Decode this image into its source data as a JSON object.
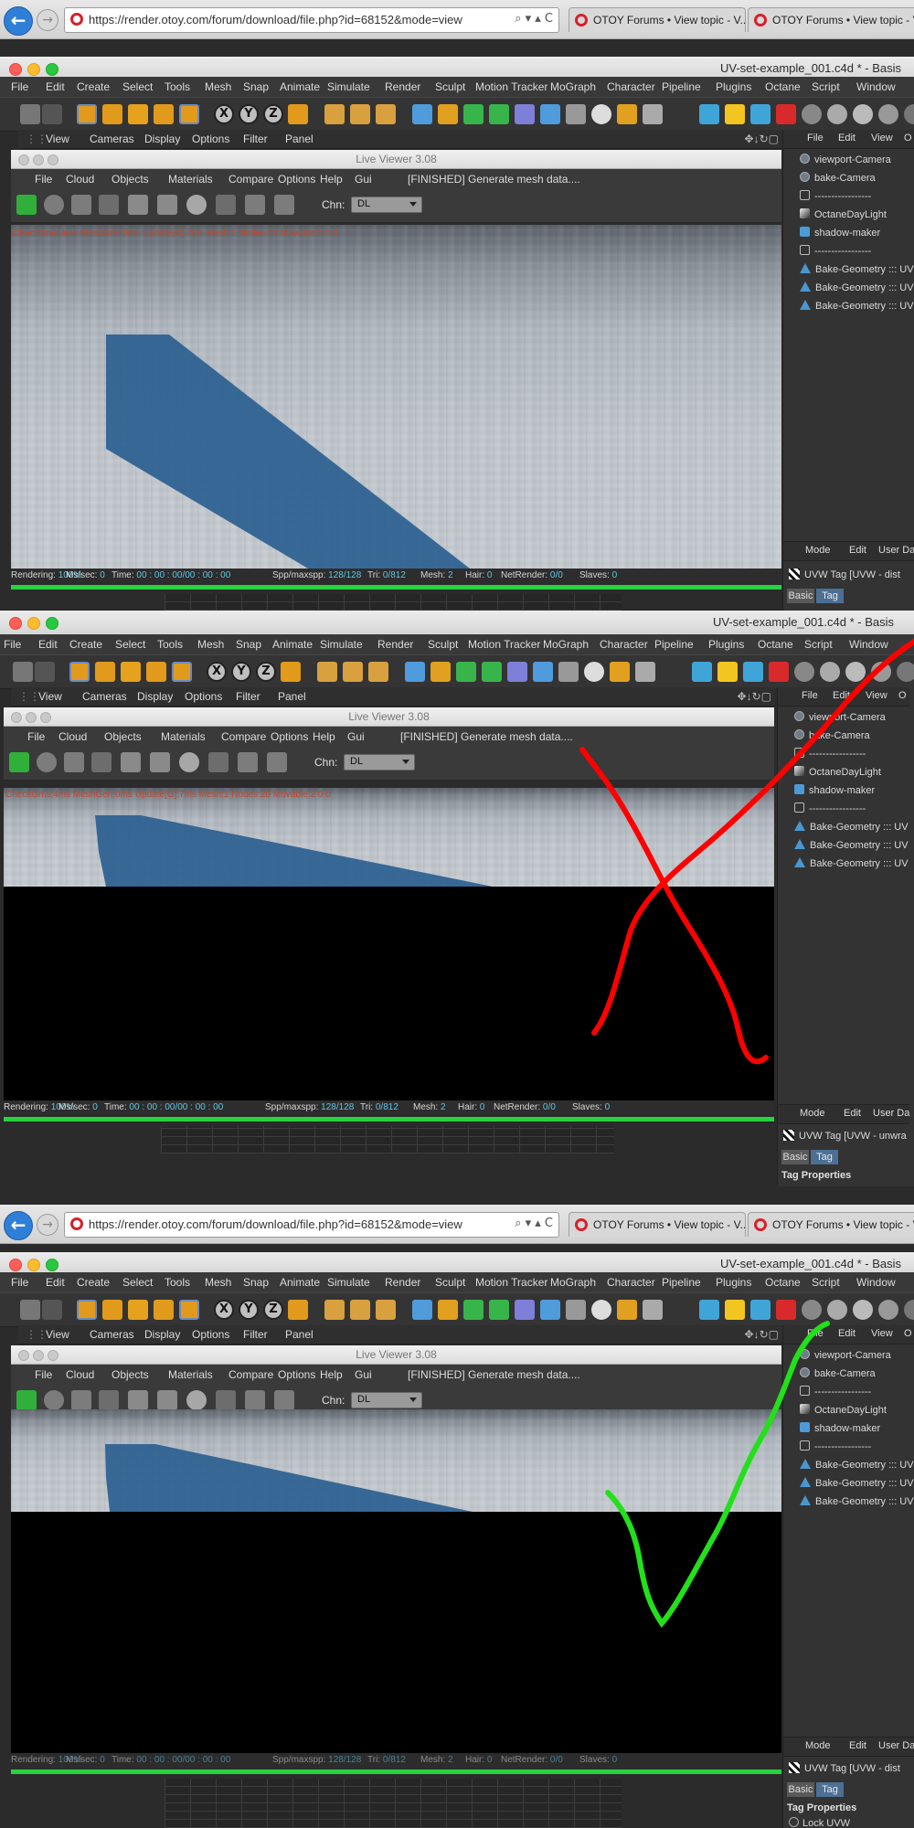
{
  "browser": {
    "url": "https://render.otoy.com/forum/download/file.php?id=68152&mode=view",
    "url_controls": "⌕ ▾ ▴ C",
    "tabs": [
      "OTOY Forums • View topic - V...",
      "OTOY Forums • View topic - V..."
    ]
  },
  "c4d": {
    "window_title": "UV-set-example_001.c4d * - Basis",
    "menu": [
      "File",
      "Edit",
      "Create",
      "Select",
      "Tools",
      "Mesh",
      "Snap",
      "Animate",
      "Simulate",
      "Render",
      "Sculpt",
      "Motion Tracker",
      "MoGraph",
      "Character",
      "Pipeline",
      "Plugins",
      "Octane",
      "Script",
      "Window"
    ],
    "viewport_menu": [
      "View",
      "Cameras",
      "Display",
      "Options",
      "Filter",
      "Panel"
    ],
    "axis_labels": [
      "X",
      "Y",
      "Z"
    ]
  },
  "live_viewer": {
    "title": "Live Viewer 3.08",
    "menu": [
      "File",
      "Cloud",
      "Objects",
      "Materials",
      "Compare",
      "Options",
      "Help",
      "Gui"
    ],
    "status_message": "[FINISHED] Generate mesh data....",
    "channel_label": "Chn:",
    "channel_value": "DL",
    "overlay_text": "CheckGms:4ms MeshGen:0ms Update[G]:7ms Mesh:1 Nodes:20 Movable:2 0 0",
    "render_status": {
      "rendering": {
        "label": "Rendering:",
        "value": "100%"
      },
      "ms_sec": {
        "label": "Ms/sec:",
        "value": "0"
      },
      "time": {
        "label": "Time:",
        "value": "00 : 00 : 00/00 : 00 : 00"
      },
      "spp": {
        "label": "Spp/maxspp:",
        "value": "128/128"
      },
      "tri": {
        "label": "Tri:",
        "value": "0/812"
      },
      "mesh": {
        "label": "Mesh:",
        "value": "2"
      },
      "hair": {
        "label": "Hair:",
        "value": "0"
      },
      "netrender": {
        "label": "NetRender:",
        "value": "0/0"
      },
      "slaves": {
        "label": "Slaves:",
        "value": "0"
      }
    }
  },
  "object_manager": {
    "menu": [
      "File",
      "Edit",
      "View",
      "O"
    ],
    "objects": [
      {
        "name": "viewport-Camera",
        "icon": "camera-icon"
      },
      {
        "name": "bake-Camera",
        "icon": "camera-icon"
      },
      {
        "name": "-----------------",
        "icon": "null-icon"
      },
      {
        "name": "OctaneDayLight",
        "icon": "daylight-icon"
      },
      {
        "name": "shadow-maker",
        "icon": "cube-icon"
      },
      {
        "name": "-----------------",
        "icon": "null-icon"
      },
      {
        "name": "Bake-Geometry ::: UV",
        "icon": "geometry-icon"
      },
      {
        "name": "Bake-Geometry ::: UV",
        "icon": "geometry-icon"
      },
      {
        "name": "Bake-Geometry ::: UV",
        "icon": "geometry-icon"
      }
    ]
  },
  "attribute_manager": {
    "menu": [
      "Mode",
      "Edit",
      "User Da"
    ],
    "tag_title_1": "UVW Tag [UVW - dist",
    "tag_title_2": "UVW Tag [UVW - unwra",
    "tabs": [
      "Basic",
      "Tag"
    ],
    "section": "Tag Properties",
    "lock_label": "Lock UVW"
  },
  "annotations": {
    "red_x_color": "#ff0000",
    "green_check_color": "#22e01a"
  }
}
